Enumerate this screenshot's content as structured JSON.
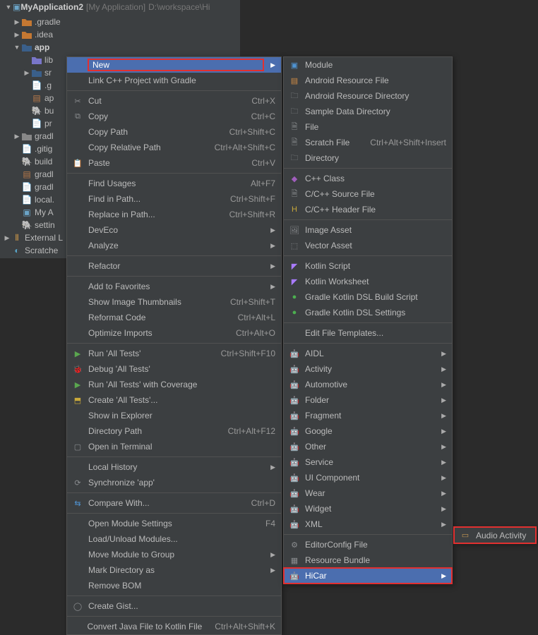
{
  "project": {
    "name": "MyApplication2",
    "bracket": "[My Application]",
    "path": "D:\\workspace\\Hi"
  },
  "tree": {
    "gradle": ".gradle",
    "idea": ".idea",
    "app": "app",
    "lib": "lib",
    "sr": "sr",
    "g": ".g",
    "ap": "ap",
    "bu": "bu",
    "pr": "pr",
    "gradl_folder": "gradl",
    "gitig": ".gitig",
    "build": "build",
    "gradl2": "gradl",
    "gradl3": "gradl",
    "local": "local.",
    "myapp": "My A",
    "settin": "settin",
    "external": "External L",
    "scratche": "Scratche"
  },
  "menu1": {
    "new": "New",
    "linkcpp": "Link C++ Project with Gradle",
    "cut": "Cut",
    "copy": "Copy",
    "copy_path": "Copy Path",
    "copy_rel": "Copy Relative Path",
    "paste": "Paste",
    "find_usages": "Find Usages",
    "find_in_path": "Find in Path...",
    "replace_in_path": "Replace in Path...",
    "deveco": "DevEco",
    "analyze": "Analyze",
    "refactor": "Refactor",
    "add_fav": "Add to Favorites",
    "show_thumb": "Show Image Thumbnails",
    "reformat": "Reformat Code",
    "optimize": "Optimize Imports",
    "run": "Run 'All Tests'",
    "debug": "Debug 'All Tests'",
    "coverage": "Run 'All Tests' with Coverage",
    "create_tests": "Create 'All Tests'...",
    "show_explorer": "Show in Explorer",
    "dir_path": "Directory Path",
    "open_terminal": "Open in Terminal",
    "local_history": "Local History",
    "sync": "Synchronize 'app'",
    "compare": "Compare With...",
    "open_module": "Open Module Settings",
    "load_unload": "Load/Unload Modules...",
    "move_group": "Move Module to Group",
    "mark_dir": "Mark Directory as",
    "remove_bom": "Remove BOM",
    "gist": "Create Gist...",
    "convert_kt": "Convert Java File to Kotlin File"
  },
  "shortcuts": {
    "cut": "Ctrl+X",
    "copy": "Ctrl+C",
    "copy_path": "Ctrl+Shift+C",
    "copy_rel": "Ctrl+Alt+Shift+C",
    "paste": "Ctrl+V",
    "find_usages": "Alt+F7",
    "find_in_path": "Ctrl+Shift+F",
    "replace_in_path": "Ctrl+Shift+R",
    "show_thumb": "Ctrl+Shift+T",
    "reformat": "Ctrl+Alt+L",
    "optimize": "Ctrl+Alt+O",
    "run": "Ctrl+Shift+F10",
    "dir_path": "Ctrl+Alt+F12",
    "compare": "Ctrl+D",
    "open_module": "F4",
    "convert_kt": "Ctrl+Alt+Shift+K",
    "scratch": "Ctrl+Alt+Shift+Insert"
  },
  "menu2": {
    "module": "Module",
    "res_file": "Android Resource File",
    "res_dir": "Android Resource Directory",
    "sample": "Sample Data Directory",
    "file": "File",
    "scratch": "Scratch File",
    "directory": "Directory",
    "cpp_class": "C++ Class",
    "cpp_src": "C/C++ Source File",
    "cpp_hdr": "C/C++ Header File",
    "img_asset": "Image Asset",
    "vec_asset": "Vector Asset",
    "kt_script": "Kotlin Script",
    "kt_ws": "Kotlin Worksheet",
    "gradle_build": "Gradle Kotlin DSL Build Script",
    "gradle_settings": "Gradle Kotlin DSL Settings",
    "edit_tpl": "Edit File Templates...",
    "aidl": "AIDL",
    "activity": "Activity",
    "automotive": "Automotive",
    "folder": "Folder",
    "fragment": "Fragment",
    "google": "Google",
    "other": "Other",
    "service": "Service",
    "ui": "UI Component",
    "wear": "Wear",
    "widget": "Widget",
    "xml": "XML",
    "editorconfig": "EditorConfig File",
    "bundle": "Resource Bundle",
    "hicar": "HiCar"
  },
  "menu3": {
    "audio": "Audio Activity"
  }
}
